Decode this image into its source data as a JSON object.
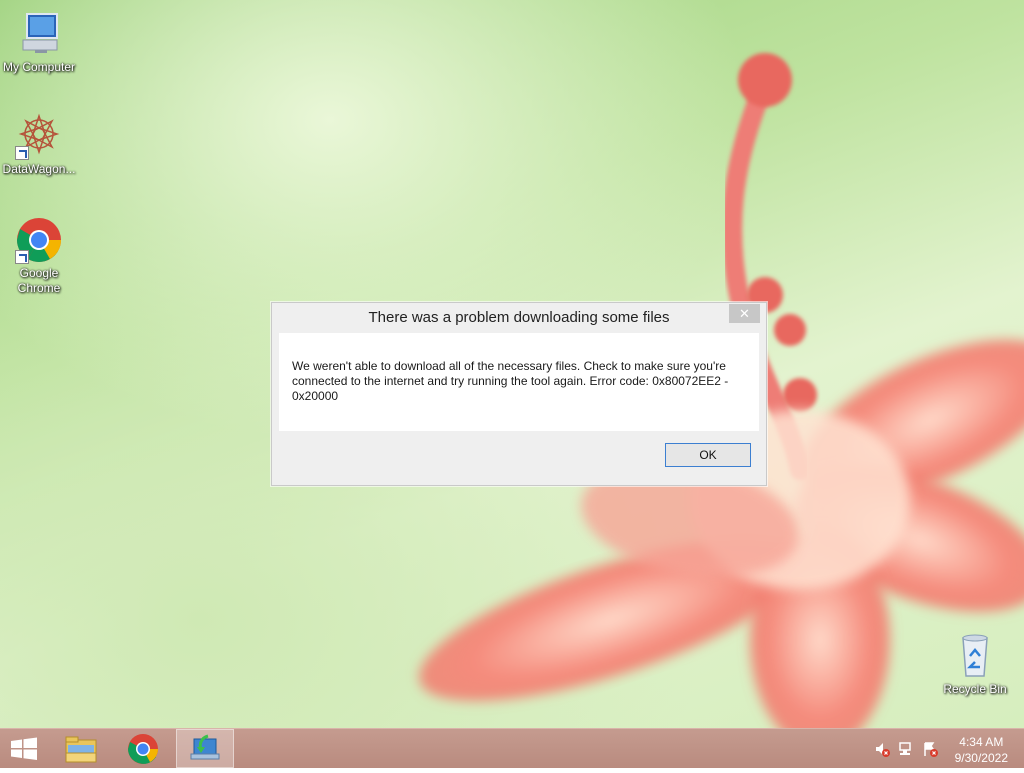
{
  "desktop": {
    "icons": [
      {
        "label": "My Computer",
        "icon": "computer-icon"
      },
      {
        "label": "DataWagon...",
        "icon": "datawagon-icon"
      },
      {
        "label": "Google Chrome",
        "icon": "chrome-icon"
      },
      {
        "label": "Recycle Bin",
        "icon": "recycle-bin-icon"
      }
    ]
  },
  "dialog": {
    "title": "There was a problem downloading some files",
    "close_glyph": "✕",
    "message": "We weren't able to download all of the necessary files. Check to make sure you're connected to the internet and try running the tool again. Error code: 0x80072EE2 - 0x20000",
    "ok_label": "OK"
  },
  "taskbar": {
    "buttons": [
      {
        "name": "start",
        "icon": "windows-logo-icon"
      },
      {
        "name": "file-explorer",
        "icon": "folder-icon"
      },
      {
        "name": "google-chrome",
        "icon": "chrome-icon"
      },
      {
        "name": "media-creation-tool",
        "icon": "setup-icon",
        "active": true
      }
    ],
    "tray": [
      {
        "icon": "volume-muted-icon"
      },
      {
        "icon": "network-icon"
      },
      {
        "icon": "action-center-icon"
      }
    ],
    "clock": {
      "time": "4:34 AM",
      "date": "9/30/2022"
    }
  },
  "colors": {
    "taskbar": "#c09589",
    "dialog_ok_border": "#3c7fd1",
    "wallpaper_green": "#bfe3a0",
    "flower_pink": "#f07a6e"
  }
}
